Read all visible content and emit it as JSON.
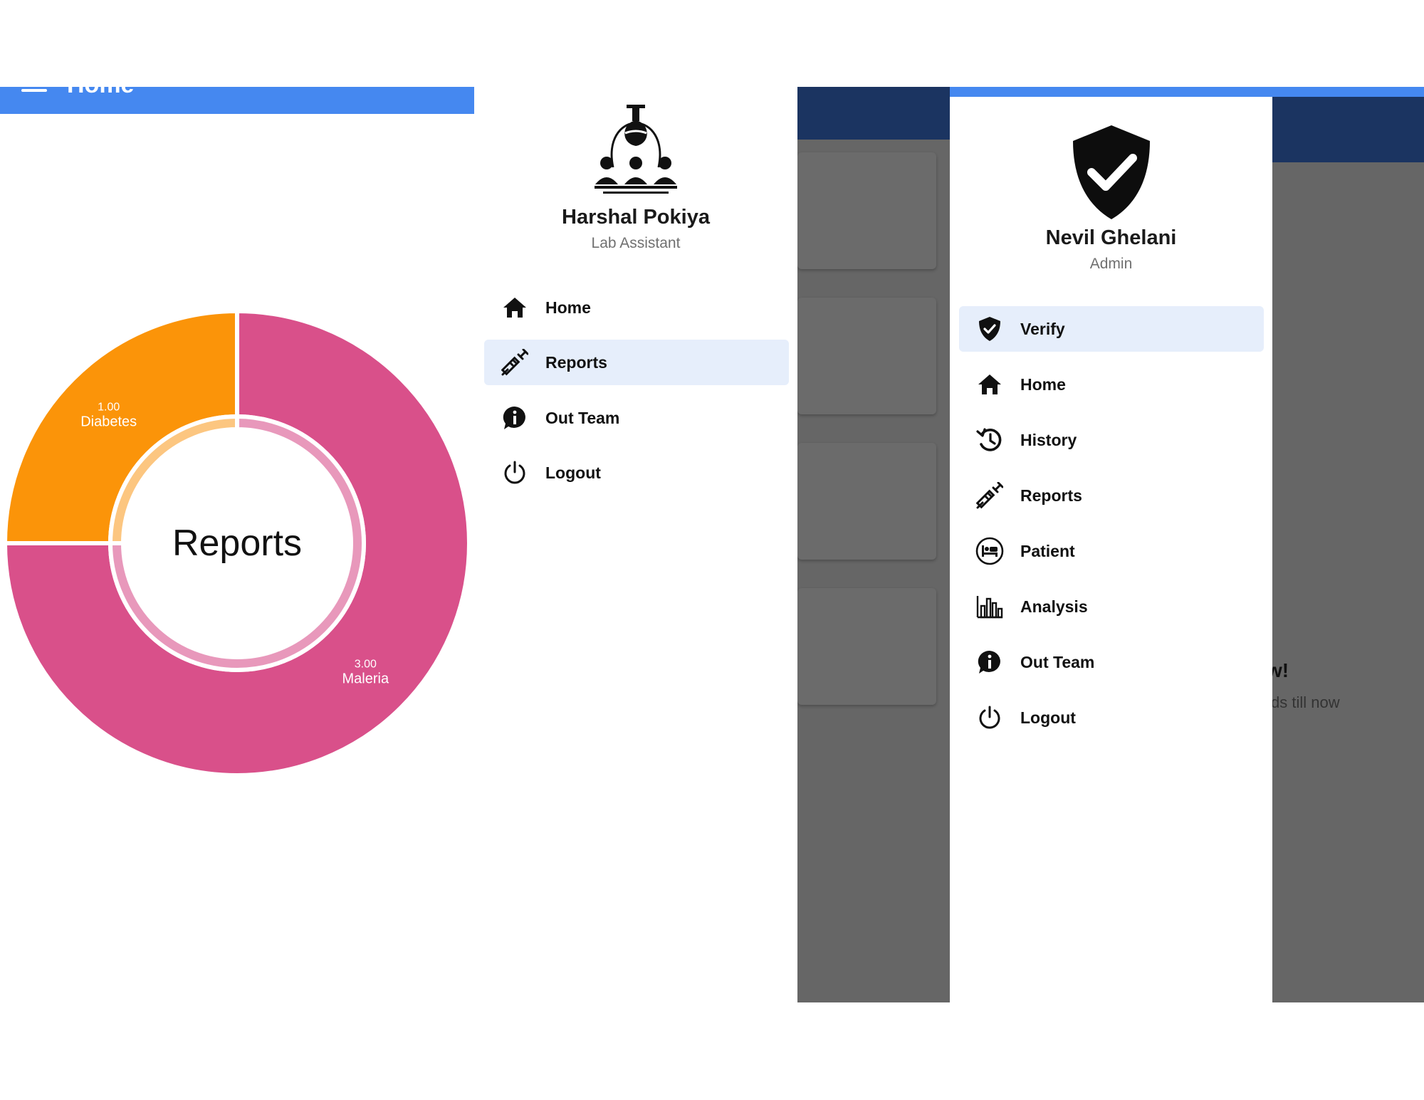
{
  "panel1": {
    "appbar": {
      "title": "Home"
    },
    "chart_data": {
      "type": "pie",
      "center_label": "Reports",
      "categories": [
        "Maleria",
        "Diabetes"
      ],
      "values": [
        3.0,
        1.0
      ],
      "value_labels": [
        "3.00",
        "1.00"
      ],
      "colors": [
        "#d9508a",
        "#fb9409"
      ],
      "inner_colors": [
        "#e898bb",
        "#fcc680"
      ]
    }
  },
  "panel2": {
    "user": {
      "name": "Harshal Pokiya",
      "role": "Lab Assistant",
      "avatar_icon": "lab-team-icon"
    },
    "nav": [
      {
        "label": "Home",
        "icon": "home-icon",
        "active": false
      },
      {
        "label": "Reports",
        "icon": "syringe-icon",
        "active": true
      },
      {
        "label": "Out Team",
        "icon": "info-bubble-icon",
        "active": false
      },
      {
        "label": "Logout",
        "icon": "power-icon",
        "active": false
      }
    ]
  },
  "panel3": {
    "user": {
      "name": "Nevil Ghelani",
      "role": "Admin",
      "avatar_icon": "shield-check-icon"
    },
    "nav": [
      {
        "label": "Verify",
        "icon": "verify-shield-icon",
        "active": true
      },
      {
        "label": "Home",
        "icon": "home-icon",
        "active": false
      },
      {
        "label": "History",
        "icon": "history-icon",
        "active": false
      },
      {
        "label": "Reports",
        "icon": "syringe-icon",
        "active": false
      },
      {
        "label": "Patient",
        "icon": "patient-bed-icon",
        "active": false
      },
      {
        "label": "Analysis",
        "icon": "bar-chart-icon",
        "active": false
      },
      {
        "label": "Out Team",
        "icon": "info-bubble-icon",
        "active": false
      },
      {
        "label": "Logout",
        "icon": "power-icon",
        "active": false
      }
    ],
    "background_peek": {
      "title_fragment": "w!",
      "subtitle_fragment": "ds till now"
    }
  },
  "colors": {
    "primary": "#4588f0",
    "navy": "#1b3461",
    "scrim": "#666666",
    "active_bg": "#e6eefb"
  }
}
